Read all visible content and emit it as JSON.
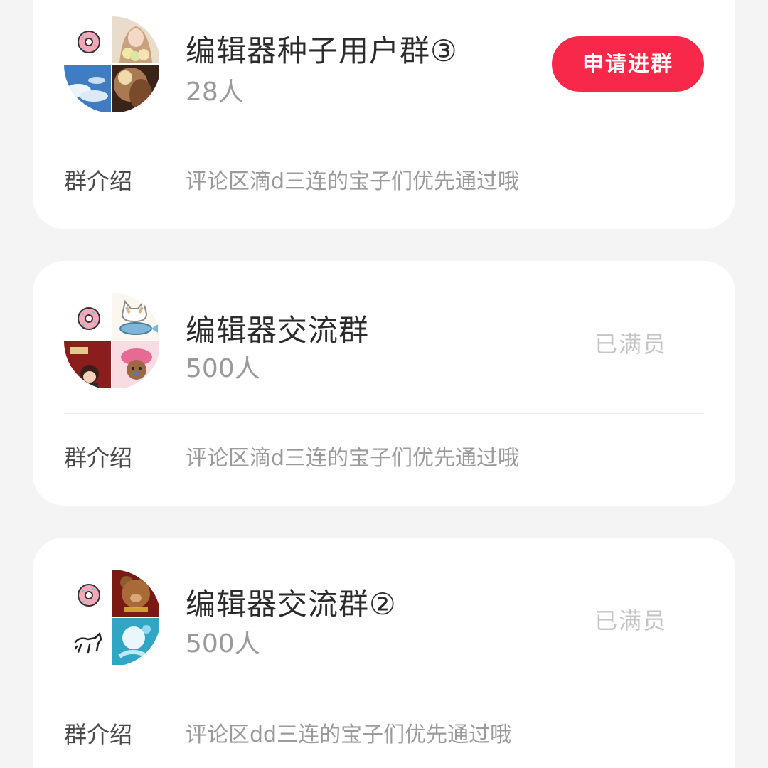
{
  "groups": [
    {
      "name": "编辑器种子用户群③",
      "member_count": "28人",
      "action": "申请进群",
      "intro_label": "群介绍",
      "intro": "评论区滴d三连的宝子们优先通过哦",
      "avatar_tiles": [
        "donut-icon",
        "girl-with-flowers-photo",
        "blue-sky-clouds-photo",
        "warm-light-portrait-photo"
      ]
    },
    {
      "name": "编辑器交流群",
      "member_count": "500人",
      "status": "已满员",
      "intro_label": "群介绍",
      "intro": "评论区滴d三连的宝子们优先通过哦",
      "avatar_tiles": [
        "donut-icon",
        "cat-and-fish-cartoon",
        "red-poster-girl-cartoon",
        "pink-hat-bear-cartoon"
      ]
    },
    {
      "name": "编辑器交流群②",
      "member_count": "500人",
      "status": "已满员",
      "intro_label": "群介绍",
      "intro": "评论区dd三连的宝子们优先通过哦",
      "avatar_tiles": [
        "donut-icon",
        "teddy-bear-photo",
        "running-dog-doodle",
        "blue-anime-art"
      ]
    }
  ],
  "colors": {
    "accent": "#f7284a",
    "background": "#f4f4f4",
    "card": "#ffffff",
    "title": "#2b2b2b",
    "muted": "#9a9a9a",
    "disabled": "#c4c4c4"
  }
}
